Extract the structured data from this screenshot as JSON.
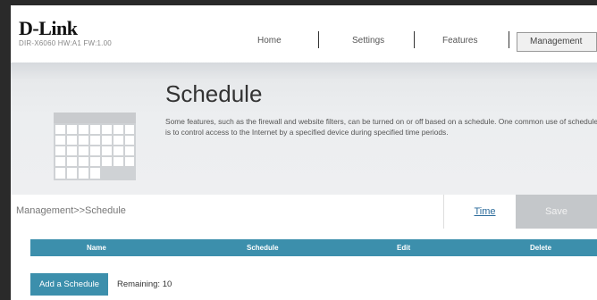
{
  "brand": {
    "logo": "D-Link",
    "model": "DIR-X6060 HW:A1 FW:1.00"
  },
  "nav": {
    "items": [
      "Home",
      "Settings",
      "Features",
      "Management"
    ],
    "active": "Management"
  },
  "banner": {
    "title": "Schedule",
    "description": "Some features, such as the firewall and website filters, can be turned on or off based on a schedule. One common use of schedules is to control access to the Internet by a specified device during specified time periods."
  },
  "breadcrumb": "Management>>Schedule",
  "actions": {
    "time_label": "Time",
    "save_label": "Save"
  },
  "table": {
    "columns": [
      "Name",
      "Schedule",
      "Edit",
      "Delete"
    ]
  },
  "add_button": "Add a Schedule",
  "remaining": "Remaining: 10",
  "colors": {
    "accent": "#3c8fac",
    "save_disabled": "#c4c7ca",
    "banner_bg": "#eceef0"
  }
}
